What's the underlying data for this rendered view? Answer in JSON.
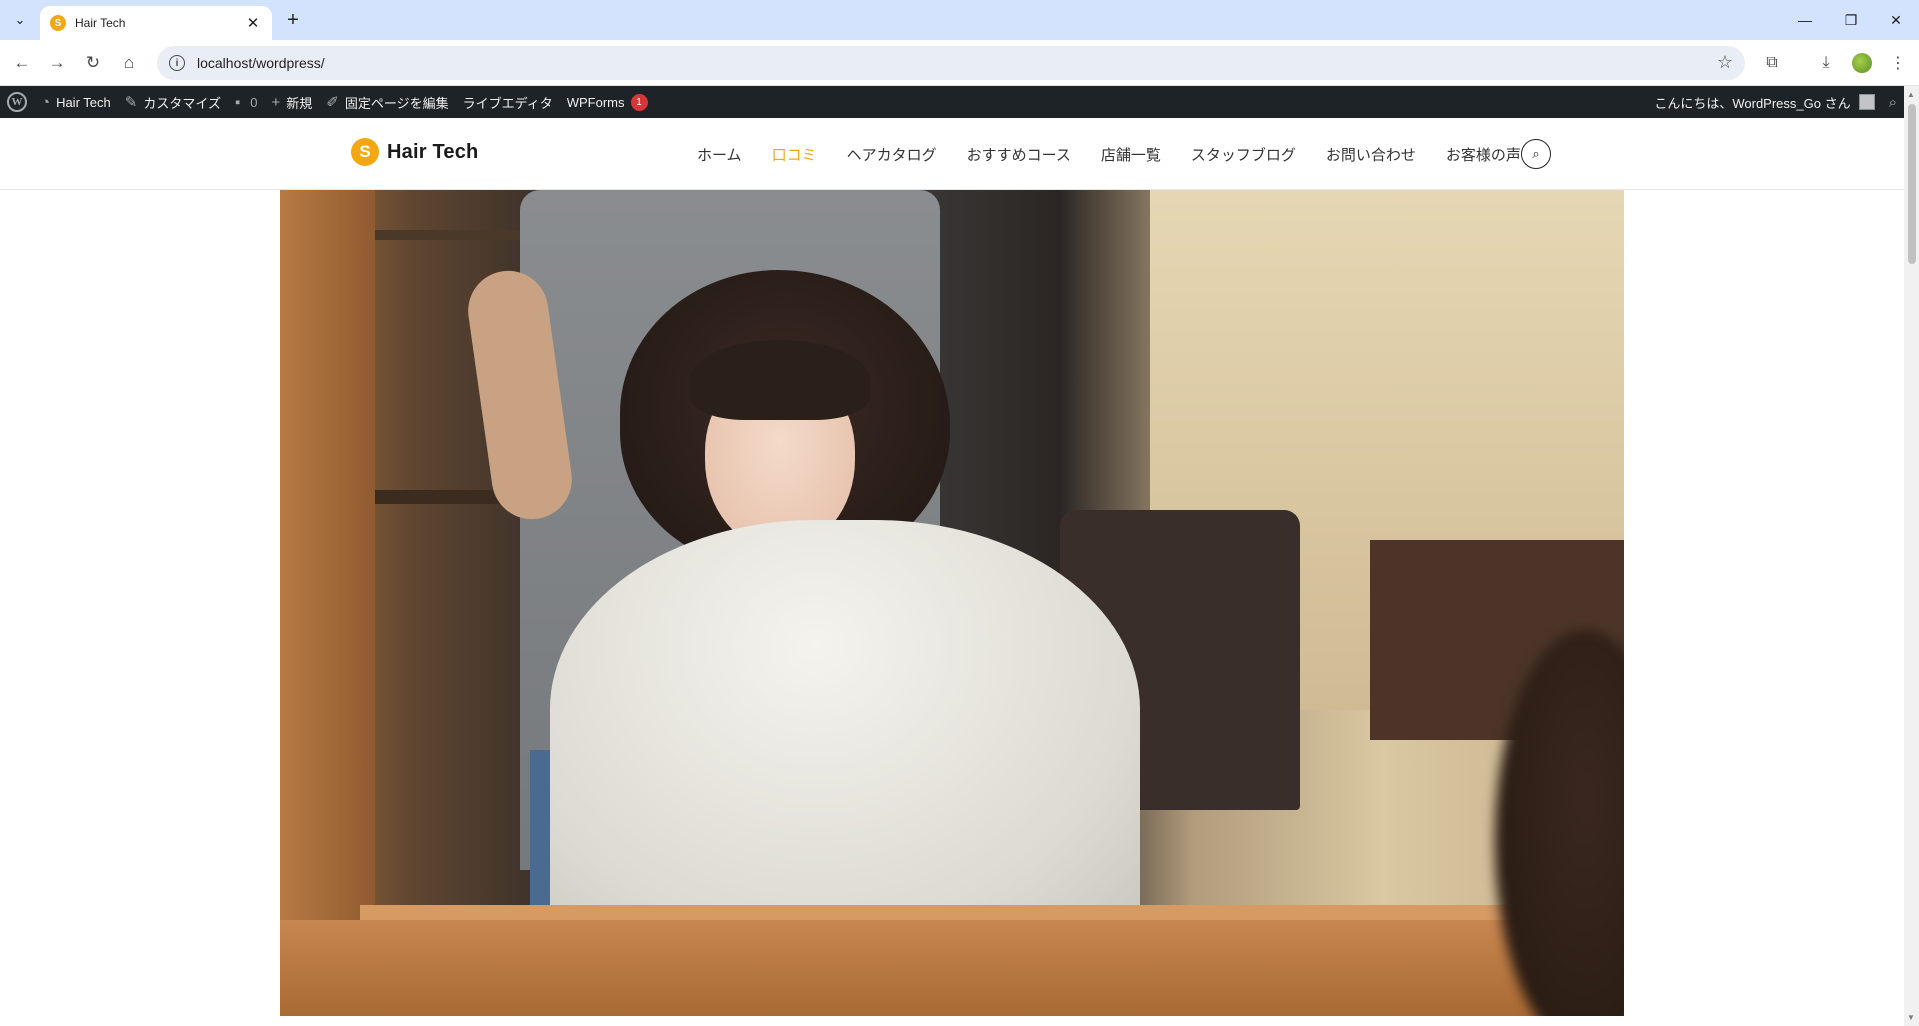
{
  "browser": {
    "tab_title": "Hair Tech",
    "tab_close": "✕",
    "new_tab": "+",
    "url": "localhost/wordpress/"
  },
  "adminbar": {
    "site_name": "Hair Tech",
    "customize": "カスタマイズ",
    "comments_count": "0",
    "new": "新規",
    "edit_page": "固定ページを編集",
    "live_editor": "ライブエディタ",
    "wpforms": "WPForms",
    "wpforms_badge": "1",
    "greeting": "こんにちは、WordPress_Go さん"
  },
  "site": {
    "logo_mark": "S",
    "logo_text": "Hair Tech",
    "nav": [
      {
        "label": "ホーム"
      },
      {
        "label": "口コミ"
      },
      {
        "label": "ヘアカタログ"
      },
      {
        "label": "おすすめコース"
      },
      {
        "label": "店舗一覧"
      },
      {
        "label": "スタッフブログ"
      },
      {
        "label": "お問い合わせ"
      },
      {
        "label": "お客様の声"
      }
    ],
    "active_nav": "口コミ",
    "accent_color": "#f3a712"
  }
}
